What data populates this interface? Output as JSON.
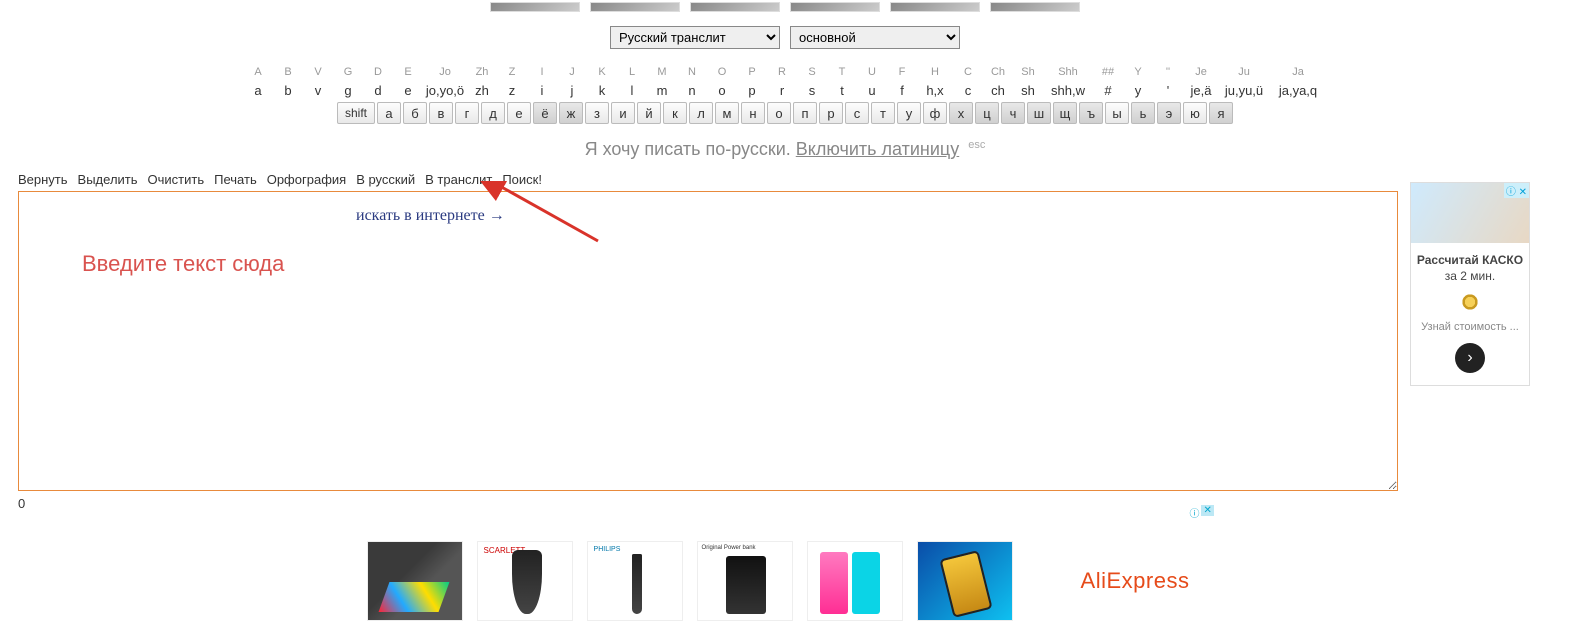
{
  "selectors": {
    "lang": "Русский транслит",
    "mode": "основной"
  },
  "keyboard": {
    "row1_hints": [
      "A",
      "B",
      "V",
      "G",
      "D",
      "E",
      "Jo",
      "Zh",
      "Z",
      "I",
      "J",
      "K",
      "L",
      "M",
      "N",
      "O",
      "P",
      "R",
      "S",
      "T",
      "U",
      "F",
      "H",
      "C",
      "Ch",
      "Sh",
      "Shh",
      "##",
      "Y",
      "''",
      "Je",
      "Ju",
      "Ja"
    ],
    "row1_keys": [
      "a",
      "b",
      "v",
      "g",
      "d",
      "e",
      "jo,yo,ö",
      "zh",
      "z",
      "i",
      "j",
      "k",
      "l",
      "m",
      "n",
      "o",
      "p",
      "r",
      "s",
      "t",
      "u",
      "f",
      "h,x",
      "c",
      "ch",
      "sh",
      "shh,w",
      "#",
      "y",
      "'",
      "je,ä",
      "ju,yu,ü",
      "ja,ya,q"
    ],
    "shift_label": "shift",
    "row2_keys": [
      "а",
      "б",
      "в",
      "г",
      "д",
      "е",
      "ё",
      "ж",
      "з",
      "и",
      "й",
      "к",
      "л",
      "м",
      "н",
      "о",
      "п",
      "р",
      "с",
      "т",
      "у",
      "ф",
      "х",
      "ц",
      "ч",
      "ш",
      "щ",
      "ъ",
      "ы",
      "ь",
      "э",
      "ю",
      "я"
    ],
    "dark_indices": [
      6,
      7,
      22,
      23,
      24,
      25,
      26,
      27,
      29,
      30,
      32
    ]
  },
  "hint": {
    "prefix": "Я хочу писать по-русски. ",
    "link": "Включить латиницу",
    "esc": "esc"
  },
  "toolbar": {
    "items": [
      "Вернуть",
      "Выделить",
      "Очистить",
      "Печать",
      "Орфография",
      "В русский",
      "В транслит",
      "Поиск!"
    ]
  },
  "editor": {
    "placeholder": "Введите текст сюда",
    "annotation": "искать в интернете",
    "counter": "0"
  },
  "side_ad": {
    "badge": "ⓘ ✕",
    "title": "Рассчитай КАСКО",
    "subtitle": "за 2 мин.",
    "linktext": "Узнай стоимость ...",
    "arrow": "›"
  },
  "bottom": {
    "brand": "AliExpress",
    "badge_i": "ⓘ",
    "badge_x": "✕"
  }
}
